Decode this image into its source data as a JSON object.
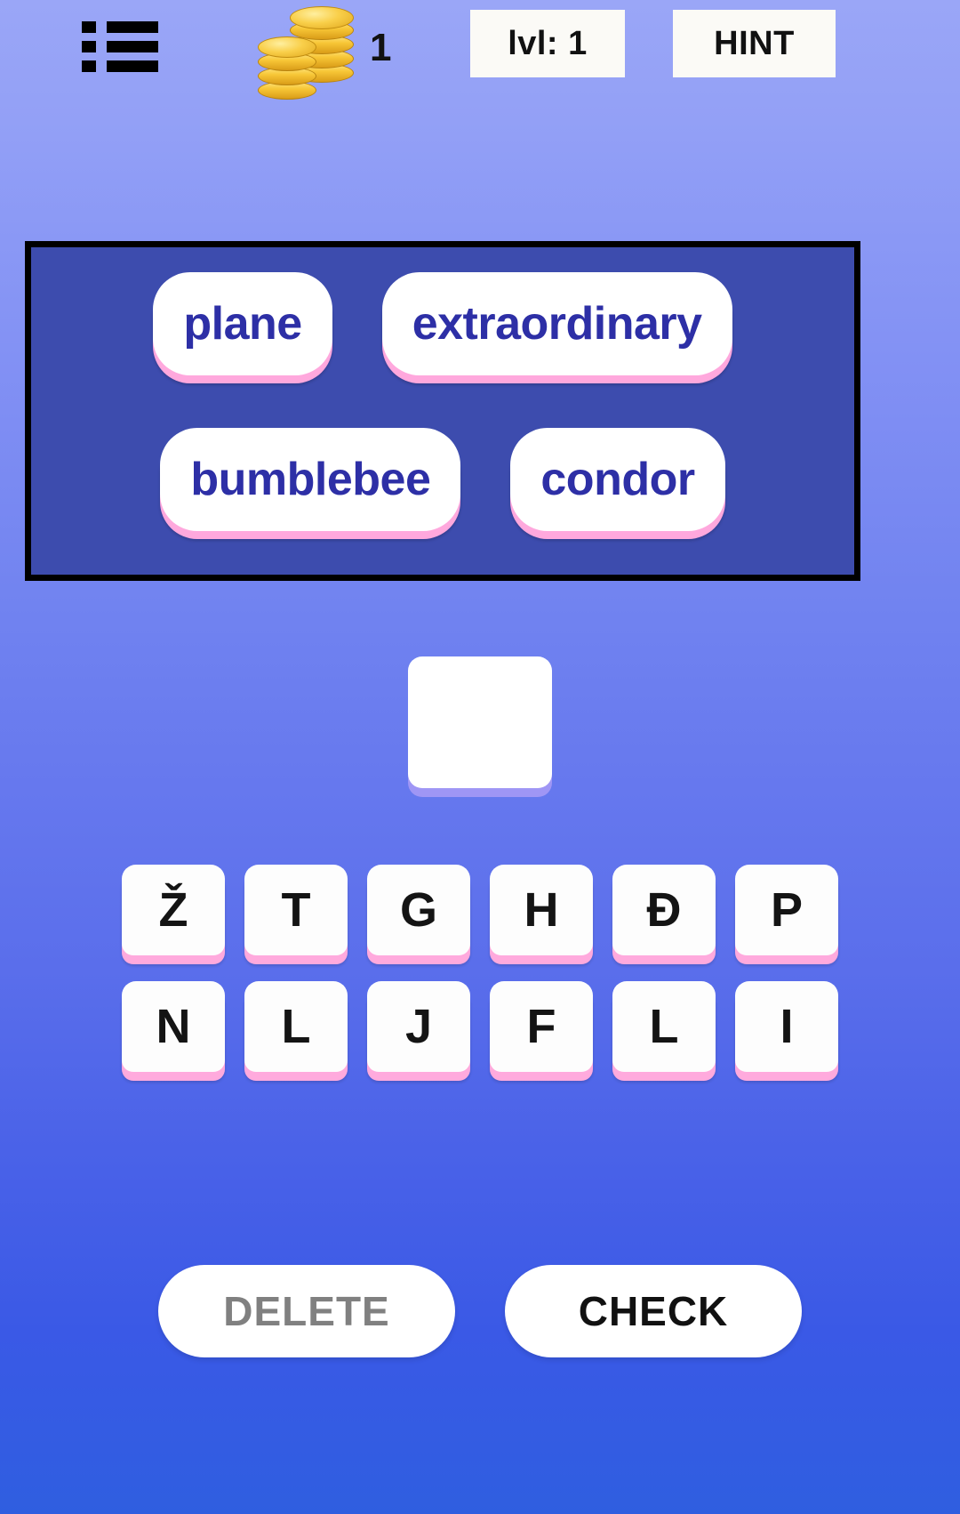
{
  "topbar": {
    "menu_icon": "hamburger-menu-icon",
    "coin_icon": "coin-stack-icon",
    "coin_count": "1",
    "level_label": "lvl: 1",
    "hint_label": "HINT"
  },
  "word_panel": {
    "rows": [
      [
        {
          "label": "plane"
        },
        {
          "label": "extraordinary"
        }
      ],
      [
        {
          "label": "bumblebee"
        },
        {
          "label": "condor"
        }
      ]
    ]
  },
  "answer": {
    "slots": [
      {
        "letter": ""
      }
    ]
  },
  "keyboard": {
    "rows": [
      [
        "Ž",
        "T",
        "G",
        "H",
        "Đ",
        "P"
      ],
      [
        "N",
        "L",
        "J",
        "F",
        "L",
        "I"
      ]
    ]
  },
  "actions": {
    "delete_label": "DELETE",
    "check_label": "CHECK"
  },
  "colors": {
    "panel_bg": "#3d4cae",
    "word_text": "#2d2fa6",
    "key_shadow_pink": "#ffaadd",
    "slot_shadow_purple": "#9f96f5",
    "delete_text": "#808080",
    "check_text": "#111111",
    "bg_top": "#9aa6f7",
    "bg_bottom": "#2f5ee0"
  }
}
